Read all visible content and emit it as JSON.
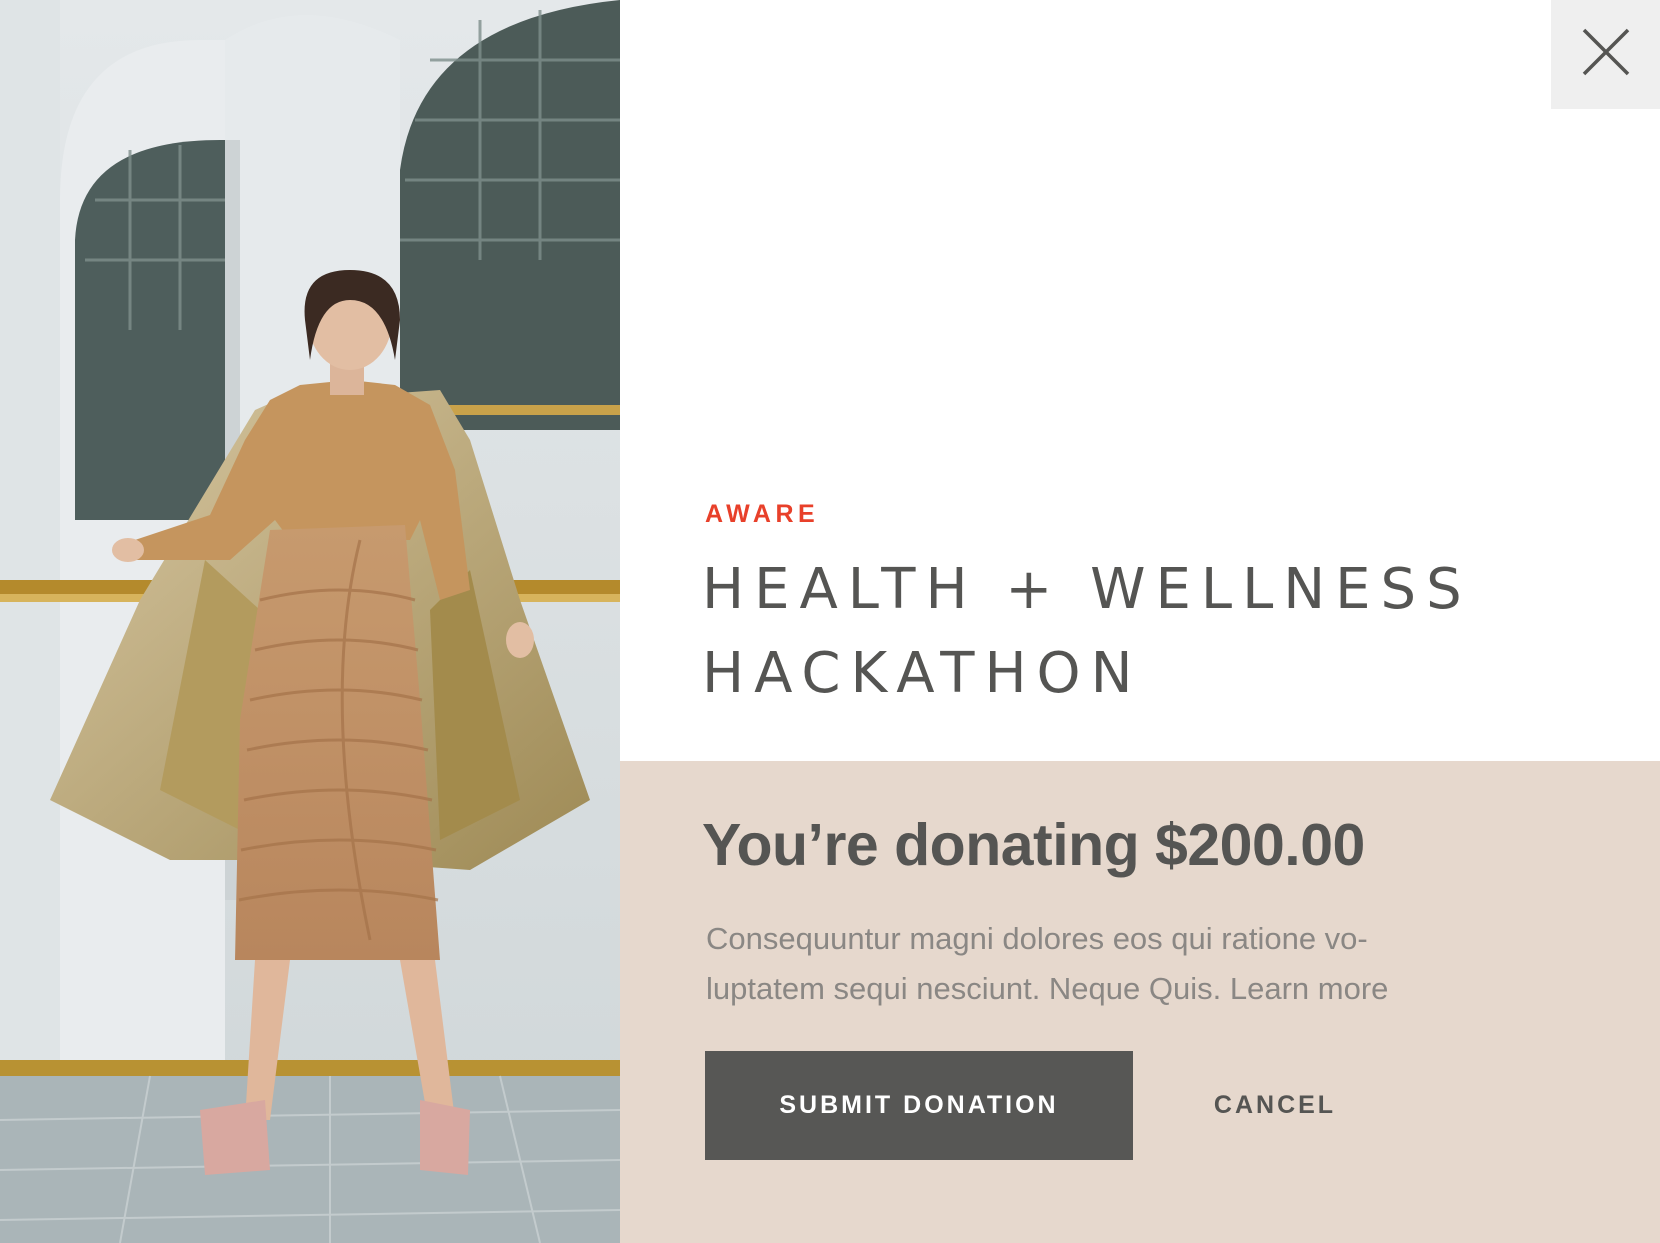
{
  "hero_image": {
    "description_icon": "fashion-photo"
  },
  "close_button": {
    "icon": "close-icon"
  },
  "campaign": {
    "eyebrow": "AWARE",
    "title_line1": "HEALTH + WELLNESS",
    "title_line2": "HACKATHON"
  },
  "donation": {
    "heading": "You’re donating $200.00",
    "description_line1": "Consequuntur magni dolores eos qui ratione vo-",
    "description_line2_prefix": "luptatem sequi nesciunt. Neque Quis. ",
    "learn_more": "Learn more",
    "submit_label": "SUBMIT DONATION",
    "cancel_label": "CANCEL"
  },
  "colors": {
    "accent": "#e8402a",
    "panel_bg": "#e6d8cd",
    "button_bg": "#575755",
    "text_dark": "#555553",
    "text_muted": "#8a8784"
  }
}
